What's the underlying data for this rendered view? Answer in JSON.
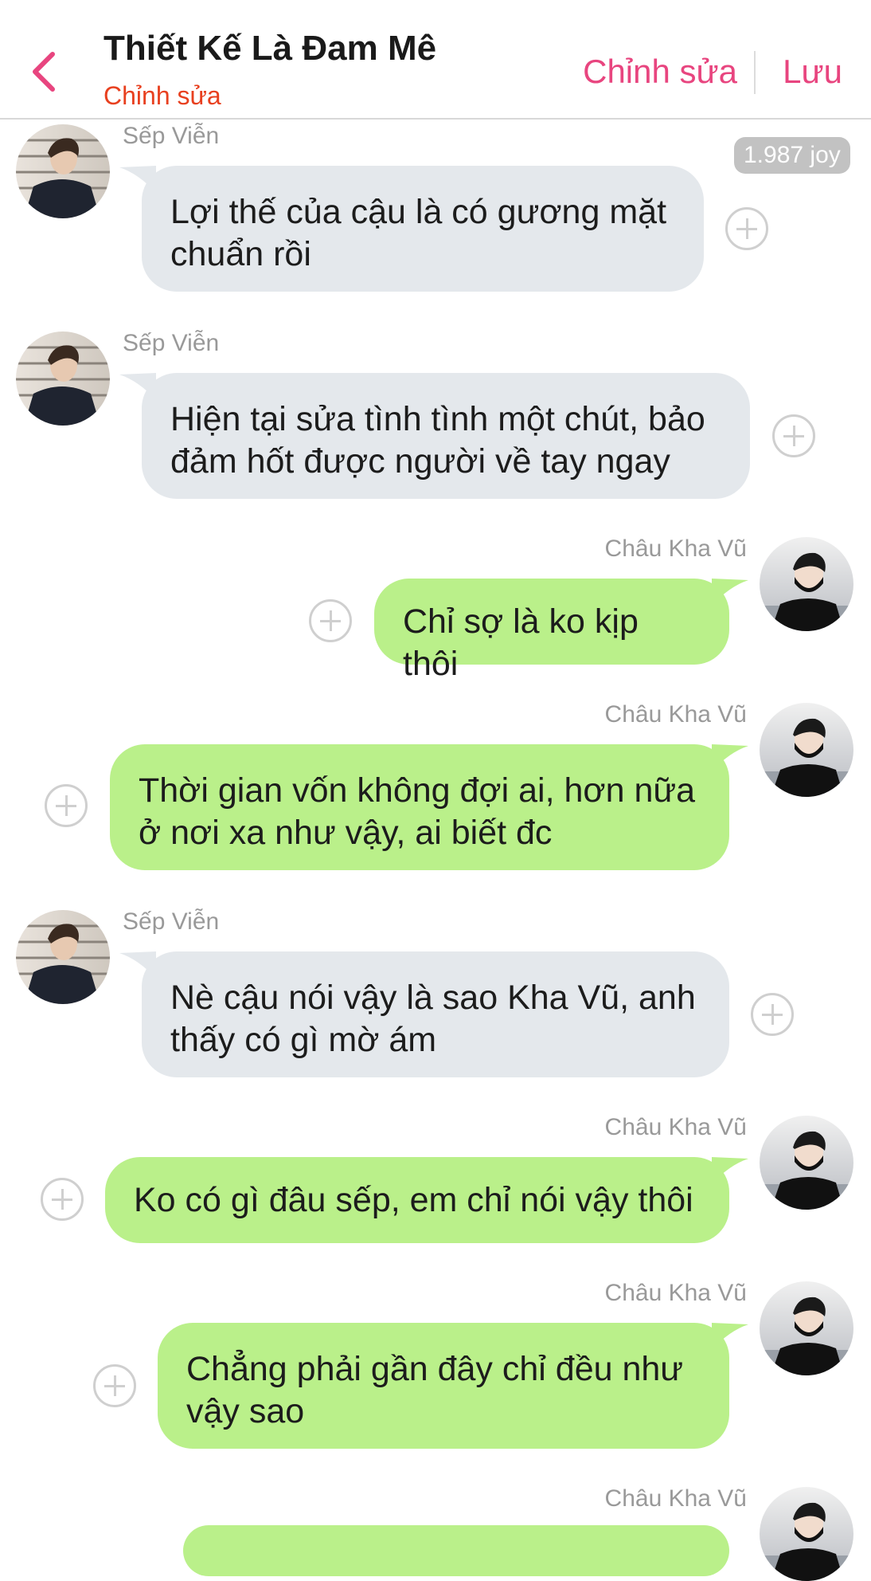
{
  "header": {
    "title": "Thiết Kế Là Đam Mê",
    "subtitle": "Chỉnh sửa",
    "edit_label": "Chỉnh sửa",
    "save_label": "Lưu"
  },
  "joy_badge": "1.987 joy",
  "messages": [
    {
      "side": "left",
      "sender": "Sếp Viễn",
      "text": "Lợi thế của cậu là có gương mặt chuẩn rồi"
    },
    {
      "side": "left",
      "sender": "Sếp Viễn",
      "text": "Hiện tại sửa tình tình một chút, bảo đảm hốt được người về tay ngay"
    },
    {
      "side": "right",
      "sender": "Châu Kha Vũ",
      "text": "Chỉ sợ là ko kịp thôi"
    },
    {
      "side": "right",
      "sender": "Châu Kha Vũ",
      "text": "Thời gian vốn không đợi ai, hơn nữa ở nơi xa như vậy, ai biết đc"
    },
    {
      "side": "left",
      "sender": "Sếp Viễn",
      "text": "Nè cậu nói vậy là sao Kha Vũ, anh thấy có gì mờ ám"
    },
    {
      "side": "right",
      "sender": "Châu Kha Vũ",
      "text": "Ko có gì đâu sếp, em chỉ nói vậy thôi"
    },
    {
      "side": "right",
      "sender": "Châu Kha Vũ",
      "text": "Chẳng phải gần đây chỉ đều như vậy sao"
    },
    {
      "side": "right",
      "sender": "Châu Kha Vũ",
      "text": ""
    }
  ],
  "colors": {
    "accent": "#e8457f",
    "subtitle": "#e8401f",
    "left_bubble": "#e4e8ec",
    "right_bubble": "#baf08a"
  },
  "icons": {
    "back": "chevron-left-icon",
    "add": "plus-circle-icon",
    "avatar": "avatar-photo"
  }
}
